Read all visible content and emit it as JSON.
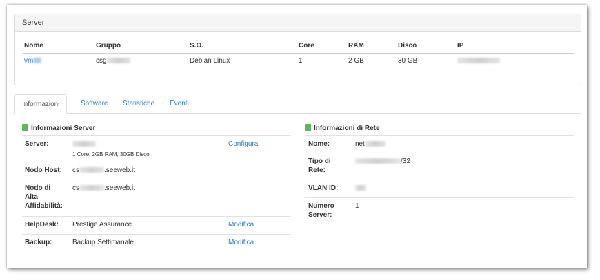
{
  "panel": {
    "title": "Server",
    "columns": [
      "Nome",
      "Gruppo",
      "S.O.",
      "Core",
      "RAM",
      "Disco",
      "IP"
    ],
    "row": {
      "nome": "vm",
      "gruppo": "csg",
      "so": "Debian Linux",
      "core": "1",
      "ram": "2 GB",
      "disco": "30 GB"
    }
  },
  "tabs": [
    "Informazioni",
    "Software",
    "Statistiche",
    "Eventi"
  ],
  "server_info": {
    "title": "Informazioni Server",
    "server_label": "Server:",
    "server_spec": "1 Core, 2GB RAM, 30GB Disco",
    "server_action": "Configura",
    "nodo_host_label": "Nodo Host:",
    "nodo_host_prefix": "cs",
    "nodo_host_suffix": ".seeweb.it",
    "nodo_alta_label_1": "Nodo di",
    "nodo_alta_label_2": "Alta",
    "nodo_alta_label_3": "Affidabilità:",
    "nodo_alta_prefix": "cs",
    "nodo_alta_suffix": ".seeweb.it",
    "helpdesk_label": "HelpDesk:",
    "helpdesk_value": "Prestige Assurance",
    "helpdesk_action": "Modifica",
    "backup_label": "Backup:",
    "backup_value": "Backup Settimanale",
    "backup_action": "Modifica"
  },
  "net_info": {
    "title": "Informazioni di Rete",
    "nome_label": "Nome:",
    "nome_prefix": "net",
    "tipo_label_1": "Tipo di",
    "tipo_label_2": "Rete:",
    "tipo_suffix": "/32",
    "vlan_label": "VLAN ID:",
    "numero_label_1": "Numero",
    "numero_label_2": "Server:",
    "numero_value": "1"
  }
}
